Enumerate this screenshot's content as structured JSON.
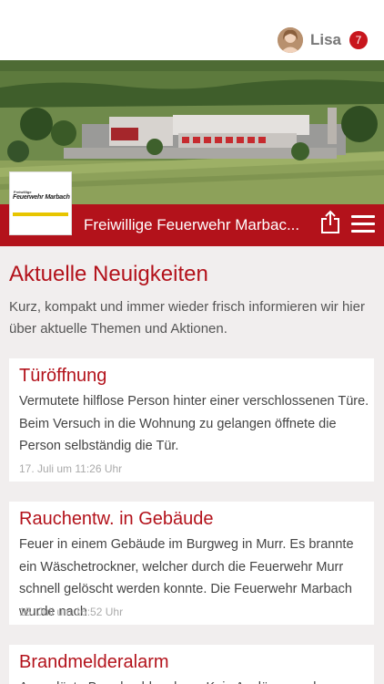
{
  "header": {
    "user_name": "Lisa",
    "notification_count": "7"
  },
  "brand": {
    "title": "Freiwillige Feuerwehr Marbac...",
    "logo_small": "Freiwillige",
    "logo_big": "Feuerwehr Marbach"
  },
  "news": {
    "heading": "Aktuelle Neuigkeiten",
    "intro": "Kurz, kompakt und immer wieder frisch informieren wir hier über aktuelle Themen und Aktionen.",
    "items": [
      {
        "title": "Türöffnung",
        "text": "Vermutete hilflose Person hinter einer verschlossenen Türe. Beim Versuch in die Wohnung zu gelangen öffnete die Person selbständig die Tür.",
        "date": "17. Juli um 11:26 Uhr"
      },
      {
        "title": "Rauchentw. in Gebäude",
        "text": "Feuer in einem Gebäude im Burgweg in Murr. Es brannte ein Wäschetrockner, welcher durch die Feuerwehr Murr schnell gelöscht werden konnte. Die Feuerwehr Marbach wurde nach",
        "date": "15. Juli um 16:52 Uhr"
      },
      {
        "title": "Brandmelderalarm",
        "text": "Ausgelöste Brandmeldeanlage. Kein Auslösegrund",
        "date": ""
      }
    ]
  },
  "colors": {
    "accent": "#b3121b",
    "badge": "#c8161d",
    "background": "#f1eeee"
  }
}
